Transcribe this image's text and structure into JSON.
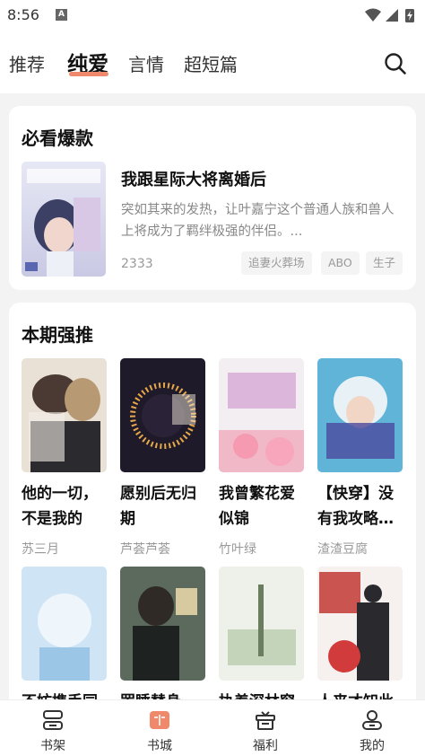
{
  "status_bar": {
    "time": "8:56",
    "notif_letter": "A"
  },
  "top_nav": {
    "tabs": [
      {
        "label": "推荐",
        "active": false
      },
      {
        "label": "纯爱",
        "active": true
      },
      {
        "label": "言情",
        "active": false
      },
      {
        "label": "超短篇",
        "active": false
      }
    ],
    "accent_color": "#f0896b"
  },
  "must_read": {
    "section_title": "必看爆款",
    "book": {
      "title": "我跟星际大将离婚后",
      "description": "突如其来的发热，让叶嘉宁这个普通人族和兽人上将成为了羁绊极强的伴侣。...",
      "count": "2333",
      "tags": [
        "追妻火葬场",
        "ABO",
        "生子"
      ]
    }
  },
  "this_issue": {
    "section_title": "本期强推",
    "books": [
      {
        "title": "他的一切，不是我的",
        "author": "苏三月"
      },
      {
        "title": "愿别后无归期",
        "author": "芦荟芦荟"
      },
      {
        "title": "我曾繁花爱似锦",
        "author": "竹叶绿"
      },
      {
        "title": "【快穿】没有我攻略…",
        "author": "渣渣豆腐"
      },
      {
        "title": "不妨携手同归去",
        "author": ""
      },
      {
        "title": "罢睡替身",
        "author": ""
      },
      {
        "title": "执着深林窗前落雨",
        "author": ""
      },
      {
        "title": "人来才知此爱深",
        "author": ""
      }
    ]
  },
  "bottom_nav": {
    "items": [
      {
        "label": "书架",
        "icon": "bookshelf-icon"
      },
      {
        "label": "书城",
        "icon": "bookstore-icon",
        "active": true
      },
      {
        "label": "福利",
        "icon": "gift-icon"
      },
      {
        "label": "我的",
        "icon": "profile-icon"
      }
    ]
  }
}
